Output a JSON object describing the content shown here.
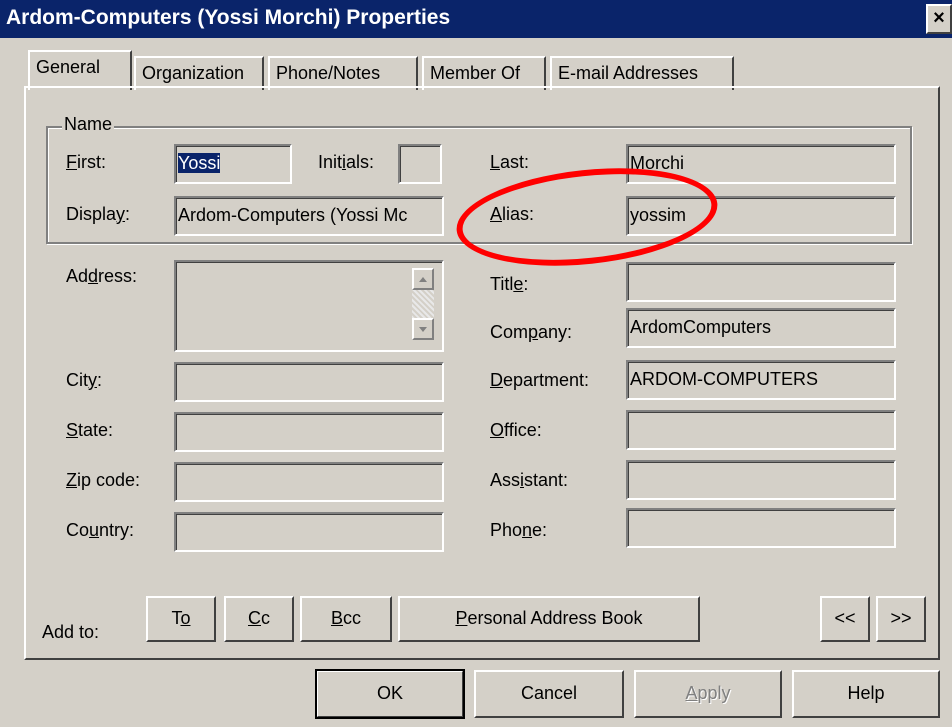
{
  "window": {
    "title": "Ardom-Computers (Yossi Morchi) Properties",
    "close_label": "×"
  },
  "tabs": [
    {
      "label": "General",
      "active": true
    },
    {
      "label": "Organization",
      "active": false
    },
    {
      "label": "Phone/Notes",
      "active": false
    },
    {
      "label": "Member Of",
      "active": false
    },
    {
      "label": "E-mail Addresses",
      "active": false
    }
  ],
  "name_group": {
    "legend": "Name",
    "first_label": "First:",
    "first_value": "Yossi",
    "initials_label": "Initials:",
    "initials_value": "",
    "last_label": "Last:",
    "last_value": "Morchi",
    "display_label": "Display:",
    "display_value": "Ardom-Computers (Yossi Mc",
    "alias_label": "Alias:",
    "alias_value": "yossim"
  },
  "address": {
    "address_label": "Address:",
    "address_value": "",
    "city_label": "City:",
    "city_value": "",
    "state_label": "State:",
    "state_value": "",
    "zip_label": "Zip code:",
    "zip_value": "",
    "country_label": "Country:",
    "country_value": ""
  },
  "org": {
    "title_label": "Title:",
    "title_value": "",
    "company_label": "Company:",
    "company_value": "ArdomComputers",
    "department_label": "Department:",
    "department_value": "ARDOM-COMPUTERS",
    "office_label": "Office:",
    "office_value": "",
    "assistant_label": "Assistant:",
    "assistant_value": "",
    "phone_label": "Phone:",
    "phone_value": ""
  },
  "add_to": {
    "label": "Add to:",
    "to": "To",
    "cc": "Cc",
    "bcc": "Bcc",
    "pab": "Personal Address Book",
    "prev": "<<",
    "next": ">>"
  },
  "buttons": {
    "ok": "OK",
    "cancel": "Cancel",
    "apply": "Apply",
    "help": "Help"
  },
  "annotation": {
    "color": "#ff0000"
  }
}
